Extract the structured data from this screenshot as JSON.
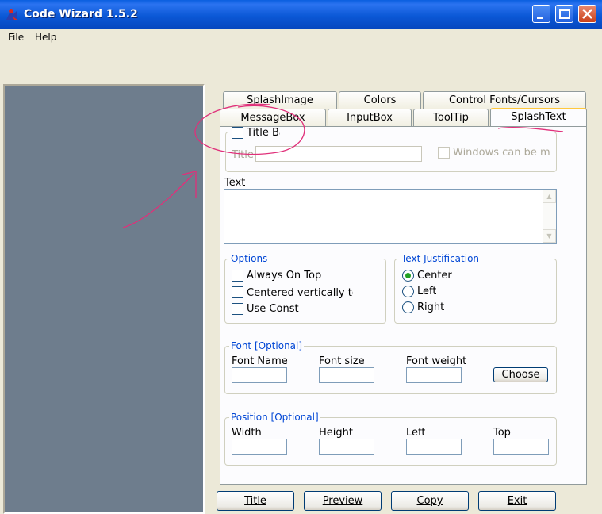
{
  "window": {
    "title": "Code Wizard 1.5.2",
    "accent": "#0A5FE0"
  },
  "menu": {
    "file": "File",
    "help": "Help"
  },
  "tabs": {
    "row1": [
      "SplashImage",
      "Colors",
      "Control Fonts/Cursors"
    ],
    "row2": [
      "MessageBox",
      "InputBox",
      "ToolTip",
      "SplashText"
    ],
    "active": "SplashText"
  },
  "title_section": {
    "checkbox_label": "Title Ba",
    "title_label": "Title",
    "title_value": "",
    "windows_move_label": "Windows can be mo"
  },
  "text_section": {
    "label": "Text",
    "value": ""
  },
  "options": {
    "title": "Options",
    "always_on_top": "Always On Top",
    "centered_vertically": "Centered vertically tex",
    "use_constant": "Use Consta"
  },
  "justification": {
    "title": "Text Justification",
    "center": "Center",
    "left": "Left",
    "right": "Right",
    "selected": "Center"
  },
  "font": {
    "title": "Font [Optional]",
    "name_label": "Font Name",
    "size_label": "Font size",
    "weight_label": "Font weight",
    "choose": "Choose",
    "name_value": "",
    "size_value": "",
    "weight_value": ""
  },
  "position": {
    "title": "Position [Optional]",
    "width_label": "Width",
    "height_label": "Height",
    "left_label": "Left",
    "top_label": "Top",
    "width_value": "",
    "height_value": "",
    "left_value": "",
    "top_value": ""
  },
  "bottom_buttons": {
    "title": "Title",
    "preview": "Preview",
    "copy": "Copy",
    "exit": "Exit"
  },
  "annotation_color": "#E0307A"
}
